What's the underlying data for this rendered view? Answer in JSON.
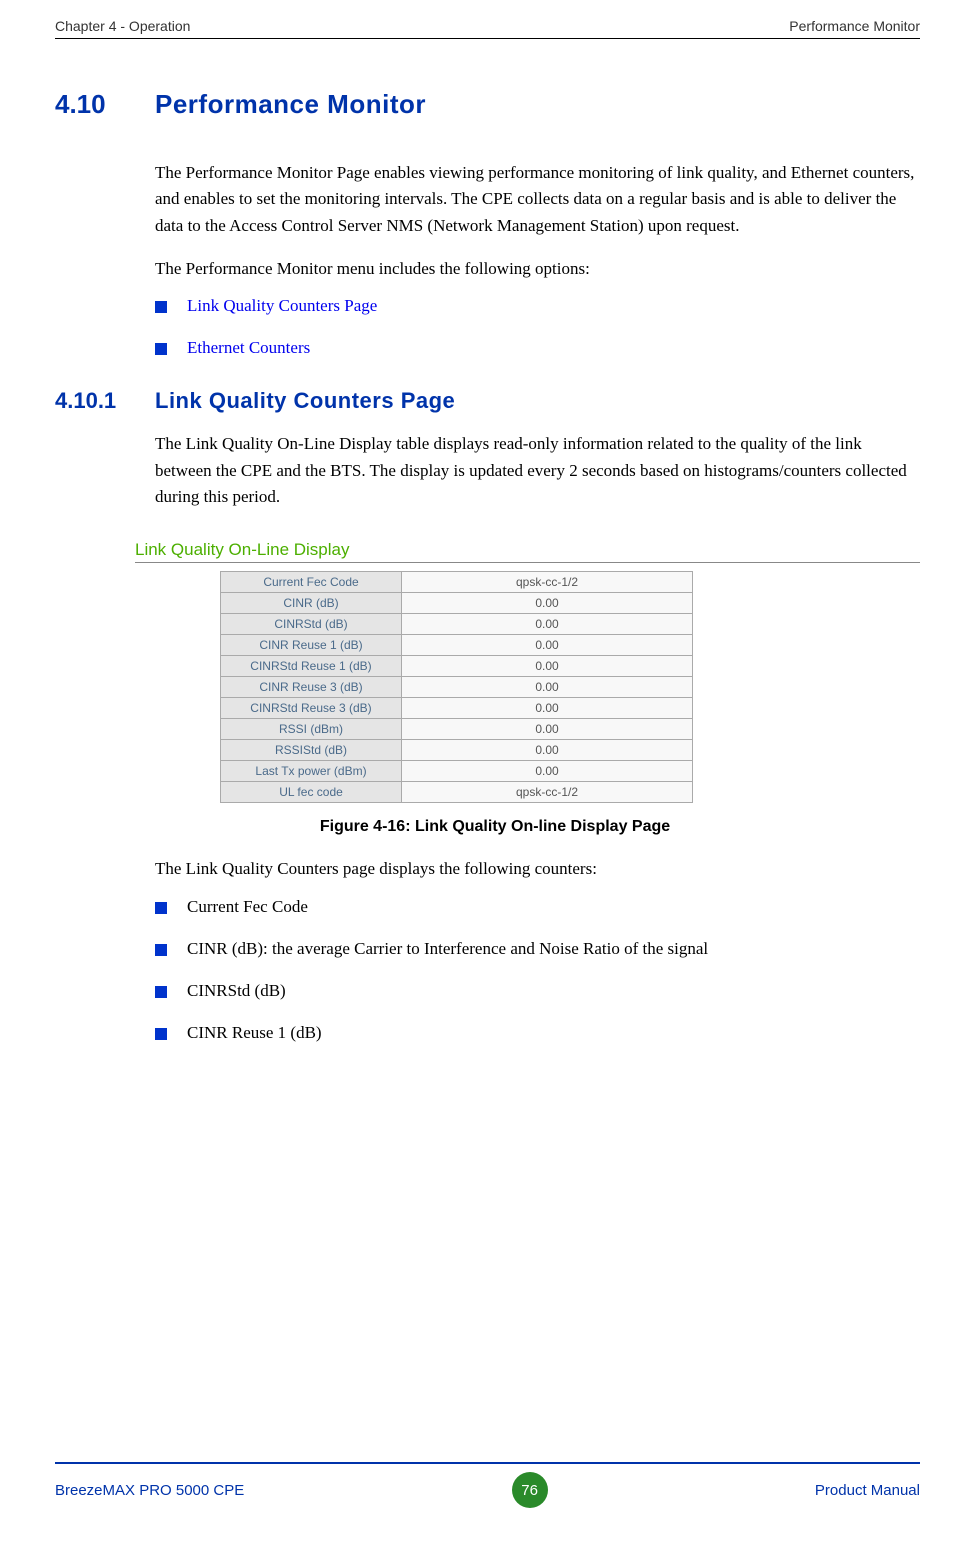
{
  "header": {
    "left": "Chapter 4 - Operation",
    "right": "Performance Monitor"
  },
  "section": {
    "number": "4.10",
    "title": "Performance Monitor"
  },
  "intro1": "The Performance Monitor Page enables viewing performance monitoring of link quality, and Ethernet counters, and enables to set the monitoring intervals. The CPE collects data on a regular basis and is able to deliver the data to the Access Control Server NMS (Network Management Station) upon request.",
  "intro2": "The Performance Monitor menu includes the following options:",
  "menu_links": [
    "Link Quality Counters Page",
    "Ethernet Counters"
  ],
  "subsection": {
    "number": "4.10.1",
    "title": "Link Quality Counters Page"
  },
  "subsection_text": "The Link Quality On-Line Display table displays read-only information related to the quality of the link between the CPE and the BTS. The display is updated every 2 seconds based on histograms/counters collected during this period.",
  "figure": {
    "heading": "Link Quality On-Line Display",
    "caption": "Figure 4-16: Link Quality On-line Display Page",
    "rows": [
      {
        "label": "Current Fec Code",
        "value": "qpsk-cc-1/2"
      },
      {
        "label": "CINR (dB)",
        "value": "0.00"
      },
      {
        "label": "CINRStd (dB)",
        "value": "0.00"
      },
      {
        "label": "CINR Reuse 1 (dB)",
        "value": "0.00"
      },
      {
        "label": "CINRStd Reuse 1 (dB)",
        "value": "0.00"
      },
      {
        "label": "CINR Reuse 3 (dB)",
        "value": "0.00"
      },
      {
        "label": "CINRStd Reuse 3 (dB)",
        "value": "0.00"
      },
      {
        "label": "RSSI (dBm)",
        "value": "0.00"
      },
      {
        "label": "RSSIStd (dB)",
        "value": "0.00"
      },
      {
        "label": "Last Tx power (dBm)",
        "value": "0.00"
      },
      {
        "label": "UL fec code",
        "value": "qpsk-cc-1/2"
      }
    ]
  },
  "counters_intro": "The Link Quality Counters page displays the following counters:",
  "counters": [
    "Current Fec Code",
    "CINR (dB): the average Carrier to Interference and Noise Ratio of the signal",
    "CINRStd (dB)",
    "CINR Reuse 1 (dB)"
  ],
  "footer": {
    "left": "BreezeMAX PRO 5000 CPE",
    "page": "76",
    "right": "Product Manual"
  }
}
